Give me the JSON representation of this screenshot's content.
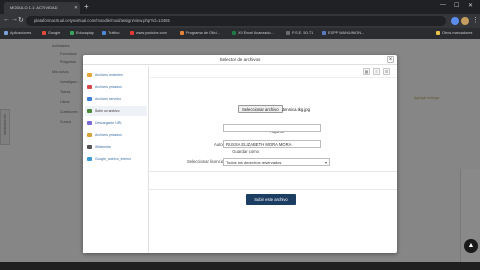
{
  "browser": {
    "tab_title": "MODULO 1.1: ACTIVIDAD",
    "url": "plataformacrtual.cetysvirtual.com/moodle/mod/assign/view.php?id=13455",
    "bookmarks": [
      {
        "label": "Aplicaciones",
        "color": "#7aa0d6"
      },
      {
        "label": "Google",
        "color": "#e24a3b"
      },
      {
        "label": "Educaplay",
        "color": "#3aa35c"
      },
      {
        "label": "Tráfico",
        "color": "#4b8bd8"
      },
      {
        "label": "www.youtube.com",
        "color": "#e53935"
      },
      {
        "label": "Programa de Ofici...",
        "color": "#e8833a"
      },
      {
        "label": "XII Excel Avanzado...",
        "color": "#1f7a45"
      },
      {
        "label": "P.S.E. 50-T1",
        "color": "#6c6c6c"
      },
      {
        "label": "ESPP WAN/UNION...",
        "color": "#5a7bbf"
      },
      {
        "label": "Otros marcadores",
        "color": "#e8c34a"
      }
    ]
  },
  "background": {
    "lines": [
      "Actividades",
      "Formulario",
      "Preguntas",
      "Mis cursos",
      "Investigaci...",
      "Tareas",
      "Libros",
      "Cuestiones",
      "Cursos"
    ],
    "side_handle": "Administración",
    "right_hint": "Agregar entrega"
  },
  "dialog": {
    "title": "Selector de archivos",
    "repositories": [
      {
        "label": "Archivos recientes",
        "color": "#e8a33a"
      },
      {
        "label": "Archivos privados",
        "color": "#d64848"
      },
      {
        "label": "Archivos servidor",
        "color": "#3a7fd6"
      },
      {
        "label": "Subir un archivo",
        "color": "#4a8a3a"
      },
      {
        "label": "Descargador URL",
        "color": "#7a6ad6"
      },
      {
        "label": "Archivos privados",
        "color": "#d6a33a"
      },
      {
        "label": "Wikimedia",
        "color": "#555555"
      },
      {
        "label": "Google_archivo_interno",
        "color": "#3a9ad6"
      }
    ],
    "active_repo_index": 3,
    "form": {
      "attachment_label": "Adjunto",
      "choose_file_label": "Seleccionar archivo",
      "selected_file": "Jennica.tkg.jpg",
      "save_as_label": "Guardar como",
      "save_as_value": "",
      "author_label": "Autor",
      "author_value": "RUSSA ELIZABETH MORA MORA",
      "license_label": "Seleccionar licencia",
      "license_value": "Todos los derechos reservados"
    },
    "upload_button": "Subir este archivo"
  }
}
